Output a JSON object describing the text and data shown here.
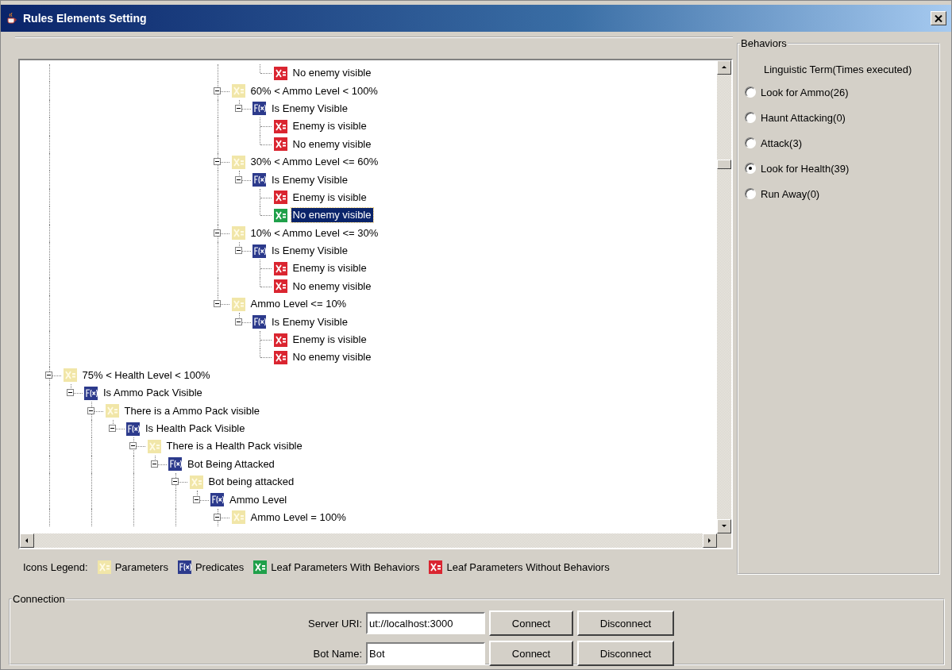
{
  "window": {
    "title": "Rules Elements Setting"
  },
  "tree": {
    "nodes": [
      {
        "children": [
          {
            "children": [
              {
                "children": [
                  {
                    "children": [
                      {
                        "children": [
                          {
                            "children": [
                              {
                                "children": [
                                  {
                                    "children": [
                                      {
                                        "children": [
                                          {
                                            "children": [
                                              {
                                                "label": "No enemy visible",
                                                "kind": "leaf_without_behavior",
                                                "selected": false
                                              }
                                            ]
                                          }
                                        ]
                                      },
                                      {
                                        "label": "60% < Ammo Level < 100%",
                                        "kind": "parameter",
                                        "expanded": true,
                                        "selected": false,
                                        "children": [
                                          {
                                            "label": "Is Enemy Visible",
                                            "kind": "predicate",
                                            "expanded": true,
                                            "selected": false,
                                            "children": [
                                              {
                                                "label": "Enemy is visible",
                                                "kind": "leaf_without_behavior",
                                                "selected": false
                                              },
                                              {
                                                "label": "No enemy visible",
                                                "kind": "leaf_without_behavior",
                                                "selected": false
                                              }
                                            ]
                                          }
                                        ]
                                      },
                                      {
                                        "label": "30% < Ammo Level <= 60%",
                                        "kind": "parameter",
                                        "expanded": true,
                                        "selected": false,
                                        "children": [
                                          {
                                            "label": "Is Enemy Visible",
                                            "kind": "predicate",
                                            "expanded": true,
                                            "selected": false,
                                            "children": [
                                              {
                                                "label": "Enemy is visible",
                                                "kind": "leaf_without_behavior",
                                                "selected": false
                                              },
                                              {
                                                "label": "No enemy visible",
                                                "kind": "leaf_with_behavior",
                                                "selected": true
                                              }
                                            ]
                                          }
                                        ]
                                      },
                                      {
                                        "label": "10% < Ammo Level <= 30%",
                                        "kind": "parameter",
                                        "expanded": true,
                                        "selected": false,
                                        "children": [
                                          {
                                            "label": "Is Enemy Visible",
                                            "kind": "predicate",
                                            "expanded": true,
                                            "selected": false,
                                            "children": [
                                              {
                                                "label": "Enemy is visible",
                                                "kind": "leaf_without_behavior",
                                                "selected": false
                                              },
                                              {
                                                "label": "No enemy visible",
                                                "kind": "leaf_without_behavior",
                                                "selected": false
                                              }
                                            ]
                                          }
                                        ]
                                      },
                                      {
                                        "label": "Ammo Level <= 10%",
                                        "kind": "parameter",
                                        "expanded": true,
                                        "selected": false,
                                        "children": [
                                          {
                                            "label": "Is Enemy Visible",
                                            "kind": "predicate",
                                            "expanded": true,
                                            "selected": false,
                                            "children": [
                                              {
                                                "label": "Enemy is visible",
                                                "kind": "leaf_without_behavior",
                                                "selected": false
                                              },
                                              {
                                                "label": "No enemy visible",
                                                "kind": "leaf_without_behavior",
                                                "selected": false
                                              }
                                            ]
                                          }
                                        ]
                                      }
                                    ]
                                  }
                                ]
                              }
                            ]
                          }
                        ]
                      }
                    ]
                  }
                ]
              }
            ]
          }
        ]
      },
      {
        "label": "75% < Health Level < 100%",
        "kind": "parameter",
        "expanded": true,
        "selected": false,
        "children": [
          {
            "label": "Is Ammo Pack Visible",
            "kind": "predicate",
            "expanded": true,
            "selected": false,
            "children": [
              {
                "label": "There is a Ammo Pack visible",
                "kind": "parameter",
                "expanded": true,
                "selected": false,
                "children": [
                  {
                    "label": "Is Health Pack Visible",
                    "kind": "predicate",
                    "expanded": true,
                    "selected": false,
                    "children": [
                      {
                        "label": "There is a Health Pack visible",
                        "kind": "parameter",
                        "expanded": true,
                        "selected": false,
                        "children": [
                          {
                            "label": "Bot Being Attacked",
                            "kind": "predicate",
                            "expanded": true,
                            "selected": false,
                            "children": [
                              {
                                "label": "Bot being attacked",
                                "kind": "parameter",
                                "expanded": true,
                                "selected": false,
                                "children": [
                                  {
                                    "label": "Ammo Level",
                                    "kind": "predicate",
                                    "expanded": true,
                                    "selected": false,
                                    "children": [
                                      {
                                        "label": "Ammo Level = 100%",
                                        "kind": "parameter",
                                        "expanded": true,
                                        "selected": false,
                                        "more_below": true
                                      }
                                    ]
                                  }
                                ],
                                "more_below": true
                              }
                            ]
                          }
                        ],
                        "more_below": true
                      }
                    ]
                  }
                ],
                "more_below": true
              }
            ]
          }
        ],
        "more_below": true
      }
    ]
  },
  "legend": {
    "title": "Icons Legend:",
    "items": [
      {
        "kind": "parameter",
        "label": "Parameters"
      },
      {
        "kind": "predicate",
        "label": "Predicates"
      },
      {
        "kind": "leaf_with_behavior",
        "label": "Leaf Parameters With Behaviors"
      },
      {
        "kind": "leaf_without_behavior",
        "label": "Leaf Parameters Without Behaviors"
      }
    ]
  },
  "behaviors": {
    "title": "Behaviors",
    "heading": "Linguistic Term(Times executed)",
    "items": [
      {
        "label": "Look for Ammo(26)",
        "selected": false
      },
      {
        "label": "Haunt Attacking(0)",
        "selected": false
      },
      {
        "label": "Attack(3)",
        "selected": false
      },
      {
        "label": "Look for Health(39)",
        "selected": true
      },
      {
        "label": "Run Away(0)",
        "selected": false
      }
    ]
  },
  "connection": {
    "title": "Connection",
    "rows": [
      {
        "label": "Server URI:",
        "value": "ut://localhost:3000",
        "buttons": [
          "Connect",
          "Disconnect"
        ]
      },
      {
        "label": "Bot Name:",
        "value": "Bot",
        "buttons": [
          "Connect",
          "Disconnect"
        ]
      }
    ]
  }
}
